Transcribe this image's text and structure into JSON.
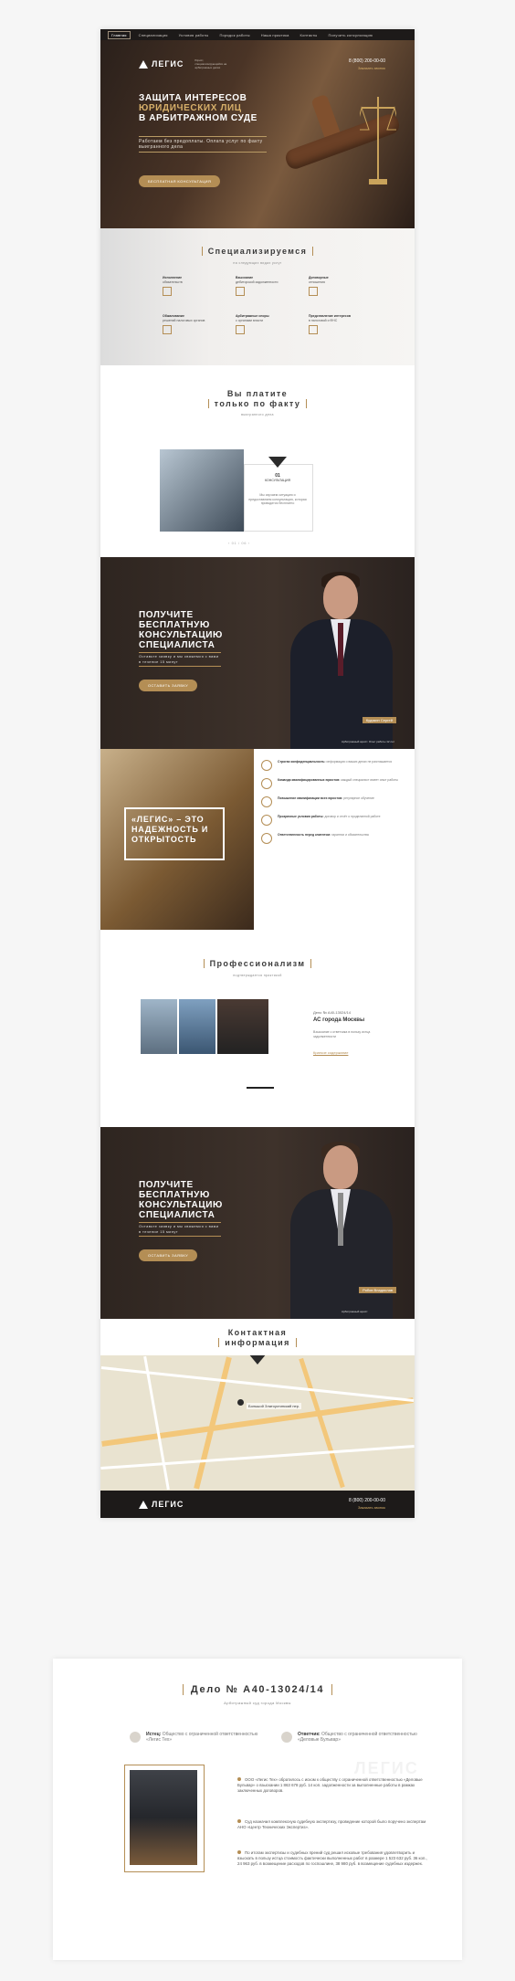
{
  "nav": {
    "items": [
      "Главная",
      "Специализация",
      "Условия работы",
      "Порядок работы",
      "Наша практика",
      "Контакты",
      "Получить консультацию"
    ]
  },
  "brand": {
    "name": "ЛЕГИС",
    "tagline": "Юрист, специализирующийся на арбитражных делах"
  },
  "header": {
    "phone": "8 (800) 200-00-00",
    "callback": "Заказать звонок"
  },
  "hero": {
    "line1": "Защита интересов",
    "line2": "юридических лиц",
    "line3": "в арбитражном суде",
    "sub": "Работаем без предоплаты. Оплата услуг по факту выигранного дела",
    "button": "Бесплатная консультация"
  },
  "spec": {
    "title": "Специализируемся",
    "subtitle": "на следующих видах услуг",
    "services": [
      {
        "title": "Исполнение",
        "text": "обязательств"
      },
      {
        "title": "Взыскание",
        "text": "дебиторской задолженности"
      },
      {
        "title": "Договорные",
        "text": "отношения"
      },
      {
        "title": "Обжалование",
        "text": "решений налоговых органов"
      },
      {
        "title": "Арбитражные споры",
        "text": "с органами власти"
      },
      {
        "title": "Представление интересов",
        "text": "в налоговой и ФНС"
      }
    ]
  },
  "pay": {
    "title1": "Вы платите",
    "title2": "только по факту",
    "subtitle": "выигранного дела",
    "card_num": "01",
    "card_title": "КОНСУЛЬТАЦИЯ",
    "card_text": "Мы изучаем ситуацию и предоставляем консультацию, которая проводится бесплатно",
    "pager": "‹ 01 / 06 ›"
  },
  "consult1": {
    "title": "Получите бесплатную консультацию специалиста",
    "sub": "Оставьте заявку и мы свяжемся с вами в течение 15 минут",
    "button": "Оставить заявку",
    "name": "Кудякин Сергей",
    "desc": "Арбитражный юрист. Опыт работы 12 лет"
  },
  "trust": {
    "banner": "«Легис» – это надежность и открытость",
    "items": [
      {
        "title": "Строгая конфиденциальность:",
        "text": "информация о ваших делах не разглашается"
      },
      {
        "title": "Команда квалифицированных юристов:",
        "text": "каждый специалист имеет опыт работы"
      },
      {
        "title": "Повышение квалификации всех юристов:",
        "text": "регулярное обучение"
      },
      {
        "title": "Прозрачные условия работы:",
        "text": "договор и отчёт о проделанной работе"
      },
      {
        "title": "Ответственность перед клиентом:",
        "text": "гарантии и обязательства"
      }
    ]
  },
  "prof": {
    "title": "Профессионализм",
    "subtitle": "подтверждается практикой",
    "case_num": "Дело № А40-13024/14",
    "court": "АС города Москвы",
    "case_text": "Взыскание с ответчика в пользу истца задолженности",
    "link": "Краткое содержание"
  },
  "consult2": {
    "title": "Получите бесплатную консультацию специалиста",
    "sub": "Оставьте заявку и мы свяжемся с вами в течение 15 минут",
    "button": "Оставить заявку",
    "name": "Рябов Владислав",
    "desc": "Арбитражный юрист"
  },
  "contact": {
    "title1": "Контактная",
    "title2": "информация",
    "map_label": "Большой Златоустинский пер."
  },
  "footer": {
    "phone": "8 (800) 200-00-00",
    "callback": "Заказать звонок"
  },
  "detail": {
    "title": "Дело № А40-13024/14",
    "court": "Арбитражный суд города Москвы",
    "plaintiff_label": "Истец:",
    "plaintiff": "Общество с ограниченной ответственностью «Легис Тех»",
    "defendant_label": "Ответчик:",
    "defendant": "Общество с ограниченной ответственностью «Деловые Бульвар»",
    "p1": "ООО «Легис Тех» обратилось с иском к обществу с ограниченной ответственностью «Деловые Бульвар» о взыскании 1 863 678 руб. 14 коп. задолженности за выполненные работы в рамках заключенных договоров.",
    "p2": "Суд назначил комплексную судебную экспертизу, проведение которой было поручено экспертам АНО «Центр Технических Экспертиз».",
    "p3": "По итогам экспертизы и судебных прений суд решил исковые требования удовлетворить и взыскать в пользу истца стоимость фактически выполненных работ в размере 1 523 632 руб. 36 коп., 24 963 руб. в возмещение расходов по госпошлине, 38 980 руб. в возмещение судебных издержек."
  }
}
